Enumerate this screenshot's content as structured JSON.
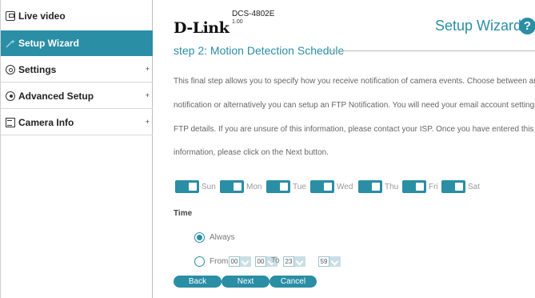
{
  "sidebar": {
    "items": [
      {
        "label": "Live video",
        "icon": "video-icon",
        "expandable": false
      },
      {
        "label": "Setup Wizard",
        "icon": "wand-icon",
        "active": true,
        "expandable": false
      },
      {
        "label": "Settings",
        "icon": "gear-icon",
        "expandable": true
      },
      {
        "label": "Advanced Setup",
        "icon": "advanced-icon",
        "expandable": true
      },
      {
        "label": "Camera Info",
        "icon": "info-icon",
        "expandable": true
      }
    ],
    "plus": "+"
  },
  "header": {
    "logo": "D-Link",
    "model": "DCS-4802E",
    "version": "1.00",
    "title": "Setup Wizard",
    "help": "?"
  },
  "step": {
    "title": "step 2: Motion Detection Schedule",
    "lines": [
      "This final step allows you to specify how you receive notification of camera events. Choose between an email",
      "notification or alternatively you can setup an FTP Notification. You will need your email account settings or",
      "FTP details. If you are unsure of this information, please contact your ISP. Once you have entered this",
      "information, please click on the Next button."
    ]
  },
  "days": [
    "Sun",
    "Mon",
    "Tue",
    "Wed",
    "Thu",
    "Fri",
    "Sat"
  ],
  "time": {
    "label": "Time",
    "always": "Always",
    "from": "From",
    "to": "To",
    "from_hour": "00",
    "from_min": "00",
    "to_hour": "23",
    "to_min": "59",
    "selected": "Always"
  },
  "buttons": {
    "back": "Back",
    "next": "Next",
    "cancel": "Cancel"
  },
  "colors": {
    "accent": "#2a8ea5"
  }
}
